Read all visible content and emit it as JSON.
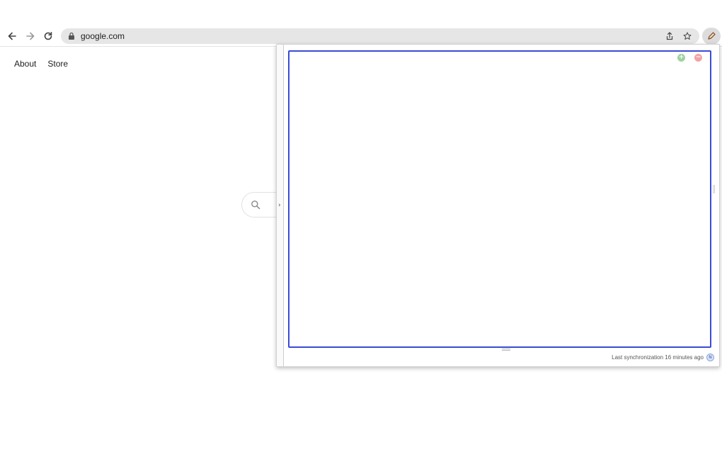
{
  "browser": {
    "url": "google.com",
    "icons": {
      "back": "arrow-left-icon",
      "forward": "arrow-right-icon",
      "reload": "reload-icon",
      "lock": "lock-icon",
      "share": "share-icon",
      "bookmark": "star-icon",
      "extension": "pen-icon"
    }
  },
  "google_page": {
    "links": [
      "About",
      "Store"
    ],
    "search_icon": "search-icon"
  },
  "extension_popup": {
    "collapse_arrow": "›",
    "add_button": "+",
    "remove_button": "−",
    "footer_status": "Last synchronization 16 minutes ago",
    "sync_icon_label": "N",
    "colors": {
      "editor_border": "#3a4bd6",
      "add": "#9ed39f",
      "remove": "#f2a4a4"
    }
  }
}
